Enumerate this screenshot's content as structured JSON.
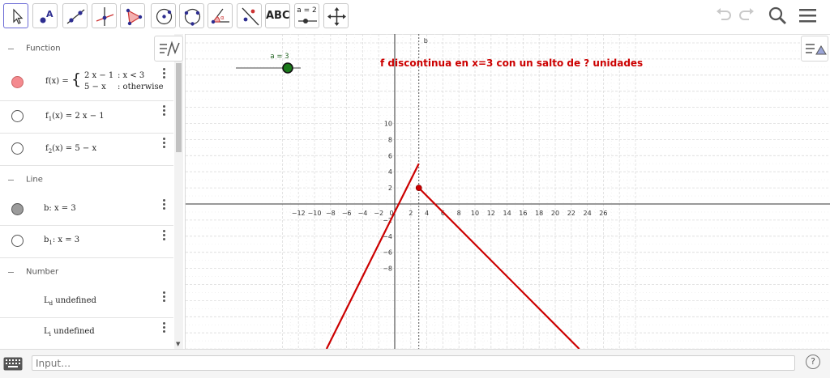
{
  "toolbar": {
    "tools": [
      {
        "name": "move-tool"
      },
      {
        "name": "point-tool"
      },
      {
        "name": "line-tool"
      },
      {
        "name": "perpendicular-line-tool"
      },
      {
        "name": "polygon-tool"
      },
      {
        "name": "circle-center-point-tool"
      },
      {
        "name": "circle-three-points-tool"
      },
      {
        "name": "angle-tool"
      },
      {
        "name": "reflect-tool"
      },
      {
        "name": "text-tool",
        "label": "ABC"
      },
      {
        "name": "slider-tool",
        "label": "a = 2"
      },
      {
        "name": "move-graphics-view-tool"
      }
    ]
  },
  "algebra": {
    "groups": {
      "function": "Function",
      "line": "Line",
      "number": "Number"
    },
    "items": {
      "f": {
        "lhs": "f(x)  =",
        "case1_expr": "2 x − 1",
        "case1_cond": ": x < 3",
        "case2_expr": "5 − x",
        "case2_cond": ": otherwise"
      },
      "f1": {
        "name": "f",
        "sub": "1",
        "rest": "(x)  =  2 x − 1"
      },
      "f2": {
        "name": "f",
        "sub": "2",
        "rest": "(x)  =  5 − x"
      },
      "b": {
        "text": "b:  x = 3"
      },
      "b1": {
        "name": "b",
        "sub": "1",
        "rest": ":  x = 3"
      },
      "ld": {
        "name": "L",
        "sub": "d",
        "rest": "  undefined"
      },
      "li": {
        "name": "L",
        "sub": "i",
        "rest": "  undefined"
      }
    }
  },
  "graphics": {
    "slider_label": "a = 3",
    "slider_value": 3,
    "annotation": "f discontinua en x=3 con un salto de ? unidades",
    "line_label": "b",
    "x_ticks": [
      "−12",
      "−10",
      "−8",
      "−6",
      "−4",
      "−2",
      "0",
      "2",
      "4",
      "6",
      "8",
      "10",
      "12",
      "14",
      "16",
      "18",
      "20",
      "22",
      "24",
      "26"
    ],
    "y_ticks": [
      "10",
      "8",
      "6",
      "4",
      "2",
      "−2",
      "−4",
      "−6",
      "−8"
    ],
    "colors": {
      "curve": "#cc0000",
      "text": "#cc0000",
      "slider_point": "#1b7a1b",
      "line_b": "#555555"
    }
  },
  "input": {
    "placeholder": "Input…",
    "help": "?"
  }
}
